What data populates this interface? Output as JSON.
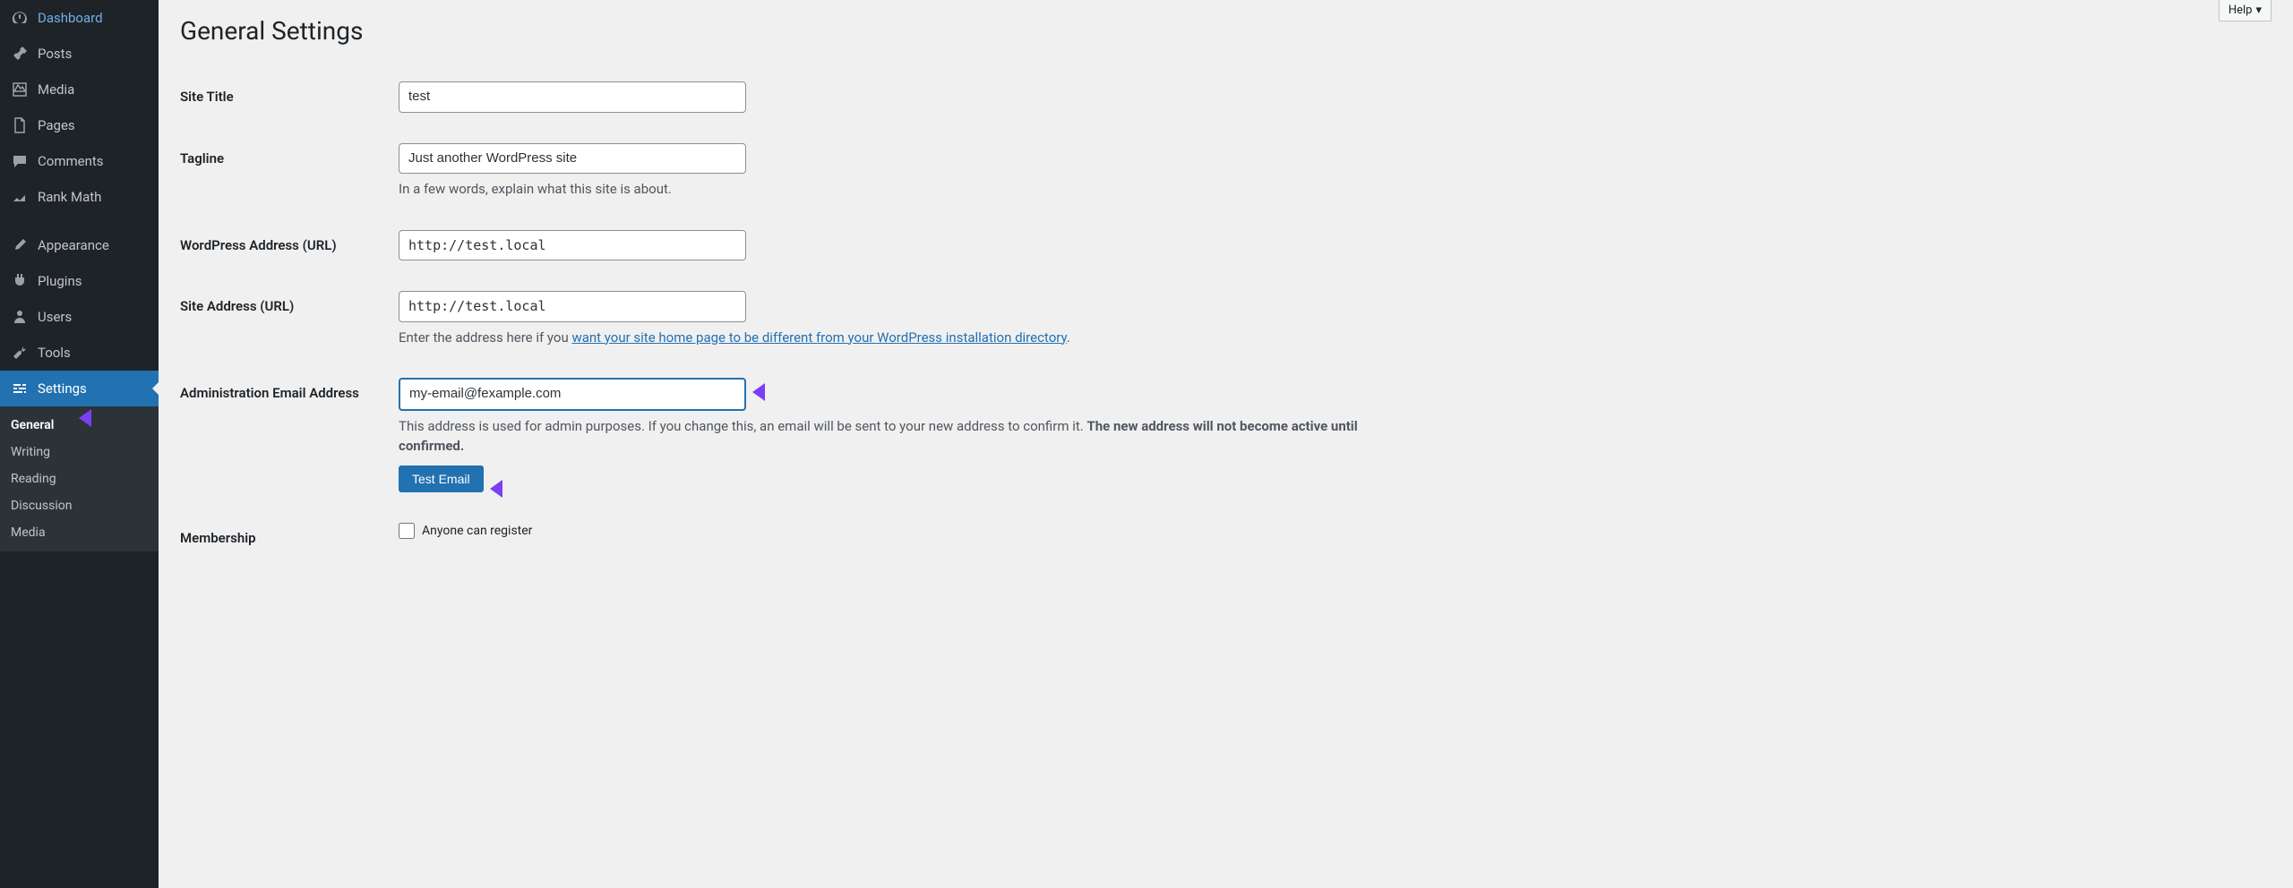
{
  "sidebar": {
    "items": [
      {
        "icon": "dashboard",
        "label": "Dashboard"
      },
      {
        "icon": "posts",
        "label": "Posts"
      },
      {
        "icon": "media",
        "label": "Media"
      },
      {
        "icon": "pages",
        "label": "Pages"
      },
      {
        "icon": "comments",
        "label": "Comments"
      },
      {
        "icon": "rankmath",
        "label": "Rank Math"
      },
      {
        "icon": "appearance",
        "label": "Appearance"
      },
      {
        "icon": "plugins",
        "label": "Plugins"
      },
      {
        "icon": "users",
        "label": "Users"
      },
      {
        "icon": "tools",
        "label": "Tools"
      },
      {
        "icon": "settings",
        "label": "Settings"
      }
    ],
    "submenu": [
      {
        "label": "General",
        "current": true
      },
      {
        "label": "Writing"
      },
      {
        "label": "Reading"
      },
      {
        "label": "Discussion"
      },
      {
        "label": "Media"
      }
    ]
  },
  "help_label": "Help",
  "page_title": "General Settings",
  "fields": {
    "site_title": {
      "label": "Site Title",
      "value": "test"
    },
    "tagline": {
      "label": "Tagline",
      "value": "Just another WordPress site",
      "hint": "In a few words, explain what this site is about."
    },
    "wp_url": {
      "label": "WordPress Address (URL)",
      "value": "http://test.local"
    },
    "site_url": {
      "label": "Site Address (URL)",
      "value": "http://test.local",
      "hint_pre": "Enter the address here if you ",
      "hint_link": "want your site home page to be different from your WordPress installation directory",
      "hint_post": "."
    },
    "admin_email": {
      "label": "Administration Email Address",
      "value": "my-email@fexample.com",
      "hint_pre": "This address is used for admin purposes. If you change this, an email will be sent to your new address to confirm it. ",
      "hint_bold": "The new address will not become active until confirmed.",
      "test_button": "Test Email"
    },
    "membership": {
      "label": "Membership",
      "checkbox": "Anyone can register"
    }
  }
}
